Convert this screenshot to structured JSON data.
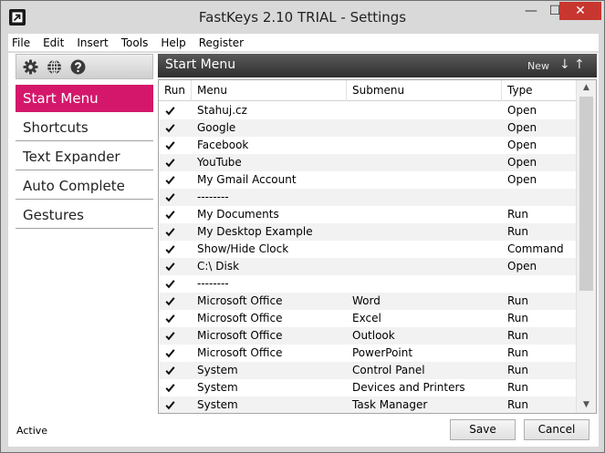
{
  "window": {
    "title": "FastKeys 2.10 TRIAL - Settings",
    "minimize_glyph": "—",
    "maximize_glyph": "☐",
    "close_glyph": "✕"
  },
  "menubar": [
    "File",
    "Edit",
    "Insert",
    "Tools",
    "Help",
    "Register"
  ],
  "toolbar": {
    "icons": [
      "gear-icon",
      "globe-icon",
      "help-icon"
    ]
  },
  "nav": {
    "items": [
      "Start Menu",
      "Shortcuts",
      "Text Expander",
      "Auto Complete",
      "Gestures"
    ],
    "active": 0
  },
  "status": "Active",
  "panel": {
    "title": "Start Menu",
    "new_label": "New",
    "down_glyph": "↓",
    "up_glyph": "↑"
  },
  "grid": {
    "columns": [
      "Run",
      "Menu",
      "Submenu",
      "Type"
    ],
    "rows": [
      {
        "run": true,
        "menu": "Stahuj.cz",
        "submenu": "",
        "type": "Open"
      },
      {
        "run": true,
        "menu": "Google",
        "submenu": "",
        "type": "Open"
      },
      {
        "run": true,
        "menu": "Facebook",
        "submenu": "",
        "type": "Open"
      },
      {
        "run": true,
        "menu": "YouTube",
        "submenu": "",
        "type": "Open"
      },
      {
        "run": true,
        "menu": "My Gmail Account",
        "submenu": "",
        "type": "Open"
      },
      {
        "run": true,
        "menu": "--------",
        "submenu": "",
        "type": ""
      },
      {
        "run": true,
        "menu": "My Documents",
        "submenu": "",
        "type": "Run"
      },
      {
        "run": true,
        "menu": "My Desktop Example",
        "submenu": "",
        "type": "Run"
      },
      {
        "run": true,
        "menu": "Show/Hide Clock",
        "submenu": "",
        "type": "Command"
      },
      {
        "run": true,
        "menu": "C:\\ Disk",
        "submenu": "",
        "type": "Open"
      },
      {
        "run": true,
        "menu": "--------",
        "submenu": "",
        "type": ""
      },
      {
        "run": true,
        "menu": "Microsoft Office",
        "submenu": "Word",
        "type": "Run"
      },
      {
        "run": true,
        "menu": "Microsoft Office",
        "submenu": "Excel",
        "type": "Run"
      },
      {
        "run": true,
        "menu": "Microsoft Office",
        "submenu": "Outlook",
        "type": "Run"
      },
      {
        "run": true,
        "menu": "Microsoft Office",
        "submenu": "PowerPoint",
        "type": "Run"
      },
      {
        "run": true,
        "menu": "System",
        "submenu": "Control Panel",
        "type": "Run"
      },
      {
        "run": true,
        "menu": "System",
        "submenu": "Devices and Printers",
        "type": "Run"
      },
      {
        "run": true,
        "menu": "System",
        "submenu": "Task Manager",
        "type": "Run"
      }
    ]
  },
  "buttons": {
    "save": "Save",
    "cancel": "Cancel"
  },
  "colors": {
    "accent": "#d4176b",
    "close_button": "#c7372f"
  }
}
